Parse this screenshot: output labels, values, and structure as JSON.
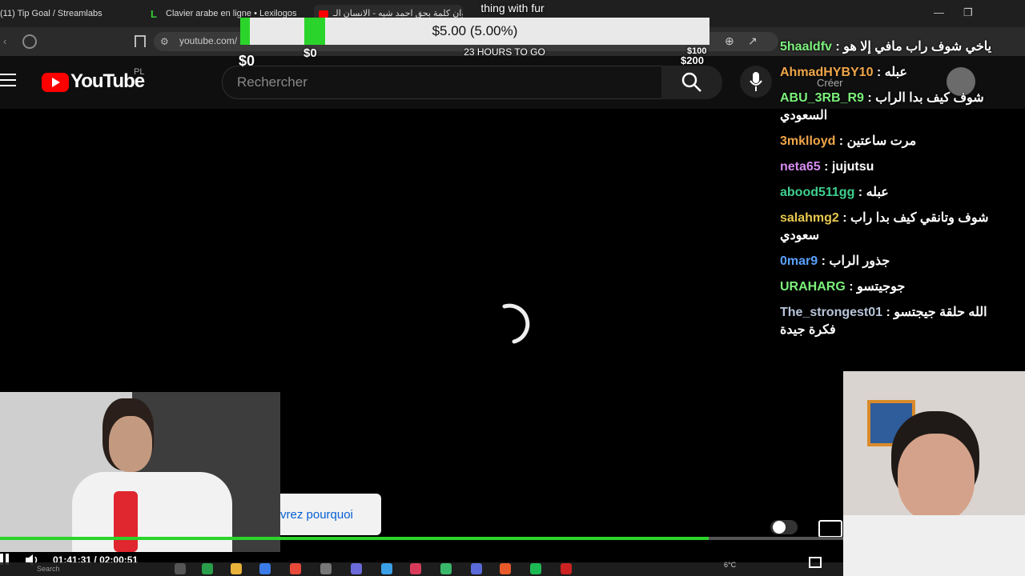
{
  "browser": {
    "tabs": [
      {
        "label": "(11) Tip Goal / Streamlabs"
      },
      {
        "label": "Clavier arabe en ligne • Lexilogos"
      },
      {
        "label": "شيلة بعنوان كلمة بحق احمد شيه - الانسان الـ"
      }
    ],
    "url": "youtube.com/"
  },
  "goal": {
    "title": "thing with fur",
    "amount_text": "$5.00 (5.00%)",
    "time_left": "23 HOURS TO GO",
    "start_label": "$0",
    "start_label_b": "$0",
    "mid_label": "$100",
    "end_label": "$200",
    "progress_percent": 5
  },
  "youtube": {
    "logo_text": "YouTube",
    "region": "PL",
    "search_placeholder": "Rechercher",
    "create_label": "Créer"
  },
  "chat": [
    {
      "user": "5haaldfv",
      "color": "#7cf07c",
      "message": "ياخي شوف راب مافي إلا هو"
    },
    {
      "user": "AhmadHYBY10",
      "color": "#f0a64a",
      "message": "عبله"
    },
    {
      "user": "ABU_3RB_R9",
      "color": "#7cf07c",
      "message": "شوف كيف بدا الراب السعودي"
    },
    {
      "user": "3mklloyd",
      "color": "#f0a64a",
      "message": "مرت ساعتين"
    },
    {
      "user": "neta65",
      "color": "#d48cf0",
      "message": "jujutsu"
    },
    {
      "user": "abood511gg",
      "color": "#3ecf8e",
      "message": "عبله"
    },
    {
      "user": "salahmg2",
      "color": "#e7c84f",
      "message": "شوف وتانقي كيف بدا راب سعودي"
    },
    {
      "user": "0mar9",
      "color": "#5aa0ff",
      "message": "جذور الراب"
    },
    {
      "user": "URAHARG",
      "color": "#7cf07c",
      "message": "جوجيتسو"
    },
    {
      "user": "The_strongest01",
      "color": "#b8c4d8",
      "message": "الله حلقة جيجتسو فكرة جيدة"
    }
  ],
  "player": {
    "current_time": "01:41:31",
    "duration": "02:00:51",
    "time_separator": "/",
    "tooltip": "vrez pourquoi",
    "progress_fraction": 0.84
  },
  "taskbar": {
    "search": "Search",
    "weather": "6°C"
  },
  "colors": {
    "goal_green": "#2bd42b",
    "youtube_red": "#ff0000",
    "progress_green": "#2bd42b"
  }
}
